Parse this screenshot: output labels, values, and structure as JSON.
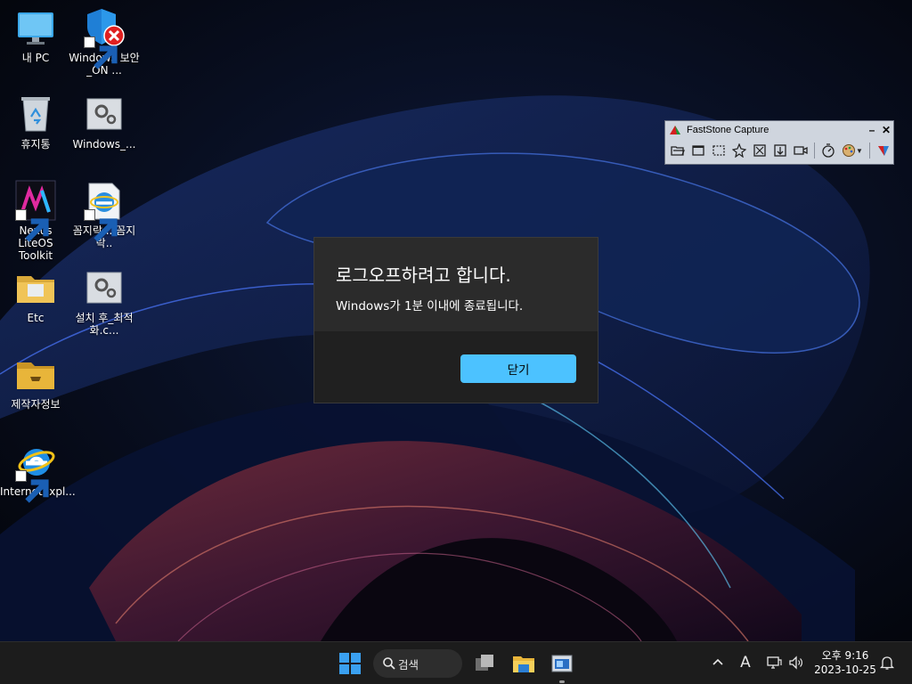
{
  "desktop": {
    "icons": [
      {
        "label": "내 PC",
        "icon": "monitor-icon"
      },
      {
        "label": "Windows 보안_ON ...",
        "icon": "windows-security-icon"
      },
      {
        "label": "휴지통",
        "icon": "recycle-bin-icon"
      },
      {
        "label": "Windows_...",
        "icon": "settings-file-icon"
      },
      {
        "label": "Nexus LiteOS Toolkit",
        "icon": "nexus-icon"
      },
      {
        "label": "꼼지락... 꼼지락..",
        "icon": "internet-explorer-file-icon"
      },
      {
        "label": "Etc",
        "icon": "folder-icon"
      },
      {
        "label": "설치 후_최적화.c...",
        "icon": "settings-file-icon"
      },
      {
        "label": "제작자정보",
        "icon": "folder-icon"
      },
      {
        "label": "InternetExpl...",
        "icon": "internet-explorer-icon"
      }
    ]
  },
  "faststone": {
    "title": "FastStone Capture",
    "minimize": "–",
    "close": "✕"
  },
  "dialog": {
    "title": "로그오프하려고 합니다.",
    "message": "Windows가 1분 이내에 종료됩니다.",
    "close_label": "닫기",
    "accent": "#4cc2ff"
  },
  "taskbar": {
    "search_label": "검색",
    "clock_time": "오후 9:16",
    "clock_date": "2023-10-25",
    "ime_label": "A"
  }
}
